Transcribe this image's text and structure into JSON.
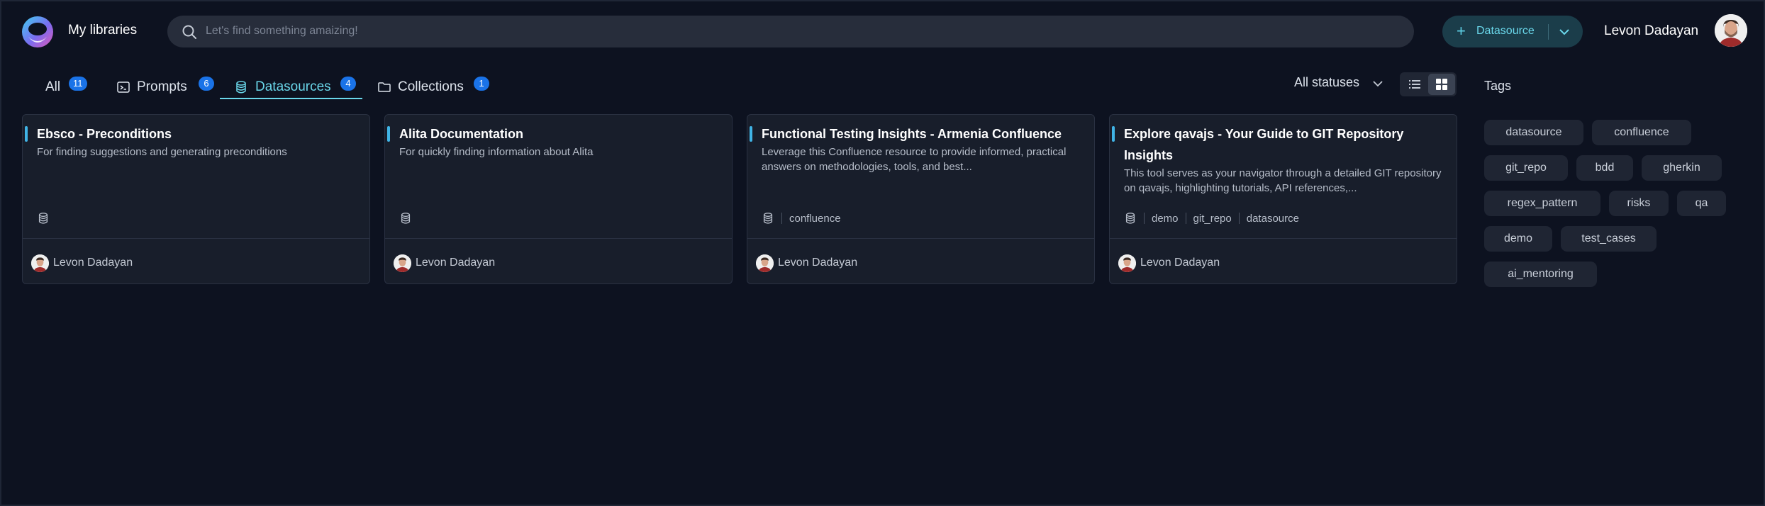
{
  "header": {
    "app_title": "My libraries",
    "search_placeholder": "Let's find something amaizing!",
    "datasource_button": "Datasource",
    "user_name": "Levon Dadayan"
  },
  "tabs": [
    {
      "label": "All",
      "count": "11",
      "icon": "none"
    },
    {
      "label": "Prompts",
      "count": "6",
      "icon": "terminal-icon"
    },
    {
      "label": "Datasources",
      "count": "4",
      "icon": "database-icon",
      "active": true
    },
    {
      "label": "Collections",
      "count": "1",
      "icon": "folder-icon"
    }
  ],
  "toolbar": {
    "status_filter": "All statuses",
    "view_mode": "grid"
  },
  "cards": [
    {
      "title": "Ebsco - Preconditions",
      "description": "For finding suggestions and generating preconditions",
      "tags": [],
      "author": "Levon Dadayan"
    },
    {
      "title": "Alita Documentation",
      "description": "For quickly finding information about Alita",
      "tags": [],
      "author": "Levon Dadayan"
    },
    {
      "title": "Functional Testing Insights - Armenia Confluence",
      "description": "Leverage this Confluence resource to provide informed, practical answers on methodologies, tools, and best...",
      "tags": [
        "confluence"
      ],
      "author": "Levon Dadayan"
    },
    {
      "title": "Explore qavajs - Your Guide to GIT Repository Insights",
      "description": "This tool serves as your navigator through a detailed GIT repository on qavajs, highlighting tutorials, API references,...",
      "tags": [
        "demo",
        "git_repo",
        "datasource"
      ],
      "author": "Levon Dadayan"
    }
  ],
  "tags_panel": {
    "title": "Tags",
    "tags": [
      "datasource",
      "confluence",
      "git_repo",
      "bdd",
      "gherkin",
      "regex_pattern",
      "risks",
      "qa",
      "demo",
      "test_cases",
      "ai_mentoring"
    ]
  },
  "colors": {
    "background": "#0d1220",
    "accent": "#6ad7ea",
    "badge": "#1a73e8",
    "card": "#181e2b"
  }
}
